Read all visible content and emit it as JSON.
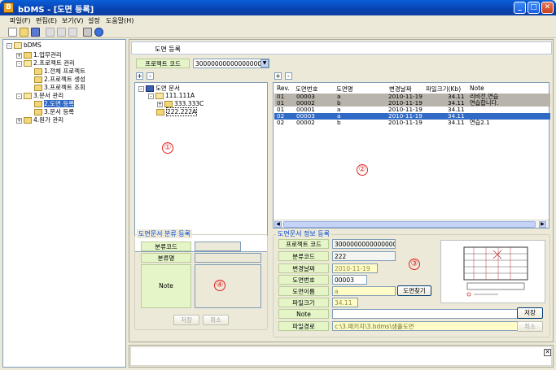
{
  "window": {
    "title": "bDMS - [도면 등록]",
    "app_icon": "B"
  },
  "menu": [
    "파일(F)",
    "편집(E)",
    "보기(V)",
    "설정",
    "도움말(H)"
  ],
  "toolbar_icons": [
    "new-icon",
    "open-icon",
    "save-icon",
    "cut-icon",
    "copy-icon",
    "paste-icon",
    "print-icon",
    "help-icon"
  ],
  "nav_tree": [
    {
      "label": "bDMS",
      "level": 0,
      "exp": "-"
    },
    {
      "label": "1.업무관리",
      "level": 1,
      "exp": "+"
    },
    {
      "label": "2.프로젝트 관리",
      "level": 1,
      "exp": "-"
    },
    {
      "label": "1.전체 프로젝트",
      "level": 2,
      "exp": ""
    },
    {
      "label": "2.프로젝트 생성",
      "level": 2,
      "exp": ""
    },
    {
      "label": "3.프로젝트 조회",
      "level": 2,
      "exp": ""
    },
    {
      "label": "3.문서 관리",
      "level": 1,
      "exp": "-"
    },
    {
      "label": "2.도면 등록",
      "level": 2,
      "exp": "",
      "selected": true
    },
    {
      "label": "3.문서 등록",
      "level": 2,
      "exp": ""
    },
    {
      "label": "4.원가 관리",
      "level": 1,
      "exp": "+"
    }
  ],
  "page": {
    "title": "도면 등록"
  },
  "project_code": {
    "label": "프로젝트 코드",
    "value": "3000000000000000003"
  },
  "doc_tree": {
    "root": "도면 문서",
    "child": "111.111A",
    "grandchild": "333.333C",
    "sibling": "222.222A"
  },
  "grid": {
    "columns": [
      "Rev.",
      "도면번호",
      "도면명",
      "변경날짜",
      "파일크기(Kb)",
      "Note"
    ],
    "rows": [
      {
        "rev": "01",
        "no": "00003",
        "name": "a",
        "date": "2010-11-19",
        "size": "34.11",
        "note": "리비전,연습",
        "style": "gray"
      },
      {
        "rev": "01",
        "no": "00002",
        "name": "b",
        "date": "2010-11-19",
        "size": "34.11",
        "note": "연습합니다.",
        "style": "gray"
      },
      {
        "rev": "01",
        "no": "00001",
        "name": "a",
        "date": "2010-11-19",
        "size": "34.11",
        "note": "",
        "style": ""
      },
      {
        "rev": "02",
        "no": "00003",
        "name": "a",
        "date": "2010-11-19",
        "size": "34.11",
        "note": "",
        "style": "sel"
      },
      {
        "rev": "02",
        "no": "00002",
        "name": "b",
        "date": "2010-11-19",
        "size": "34.11",
        "note": "연습2.1",
        "style": ""
      }
    ]
  },
  "markers": [
    "①",
    "②",
    "③",
    "④"
  ],
  "class_box": {
    "title": "도면문서 분류 등록",
    "code_label": "분류코드",
    "name_label": "분류명",
    "note_label": "Note",
    "save": "저장",
    "cancel": "취소"
  },
  "info_box": {
    "title": "도면문서 정보 등록",
    "project_code_label": "프로젝트 코드",
    "project_code": "3000000000000000003",
    "class_code_label": "분류코드",
    "class_code": "222",
    "date_label": "변경날짜",
    "date": "2010-11-19",
    "no_label": "도면번호",
    "no": "00003",
    "name_label": "도면이름",
    "name": "a",
    "find_button": "도면찾기",
    "size_label": "파일크기",
    "size": "34.11",
    "note_label": "Note",
    "path_label": "파일경로",
    "path": "c:\\3.패키지\\3.bdms\\샘플도면",
    "save": "저장",
    "cancel": "취소"
  },
  "colors": {
    "titlebar": "#0842b0",
    "selection": "#316ac5",
    "label_green": "#e5f5c8",
    "marker_red": "#e02020"
  }
}
